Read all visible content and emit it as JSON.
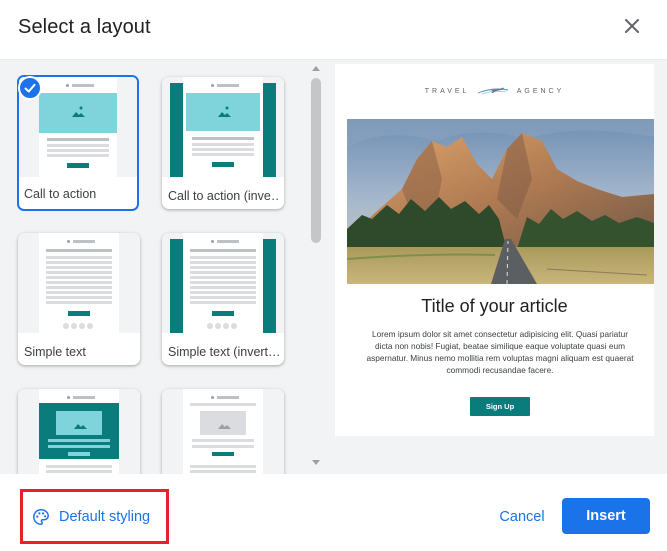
{
  "dialog": {
    "title": "Select a layout"
  },
  "layouts": [
    {
      "label": "Call to action",
      "selected": true
    },
    {
      "label": "Call to action (inve…",
      "selected": false
    },
    {
      "label": "Simple text",
      "selected": false
    },
    {
      "label": "Simple text (invert…",
      "selected": false
    },
    {
      "label": "",
      "selected": false
    },
    {
      "label": "",
      "selected": false
    }
  ],
  "preview": {
    "brand_left": "TRAVEL",
    "brand_right": "AGENCY",
    "article_title": "Title of your article",
    "article_body": "Lorem ipsum dolor sit amet consectetur adipisicing elit. Quasi pariatur dicta non nobis! Fugiat, beatae similique eaque voluptate quasi eum aspernatur. Minus nemo mollitia rem voluptas magni aliquam est quaerat commodi recusandae facere.",
    "button_label": "Sign Up"
  },
  "footer": {
    "default_styling_label": "Default styling",
    "cancel_label": "Cancel",
    "insert_label": "Insert"
  },
  "colors": {
    "accent": "#1a73e8",
    "teal": "#0b7c7c",
    "light_teal": "#7fd4dc",
    "highlight_border": "#e3222d"
  },
  "icons": {
    "close": "close-icon",
    "check": "check-icon",
    "palette": "palette-icon"
  }
}
